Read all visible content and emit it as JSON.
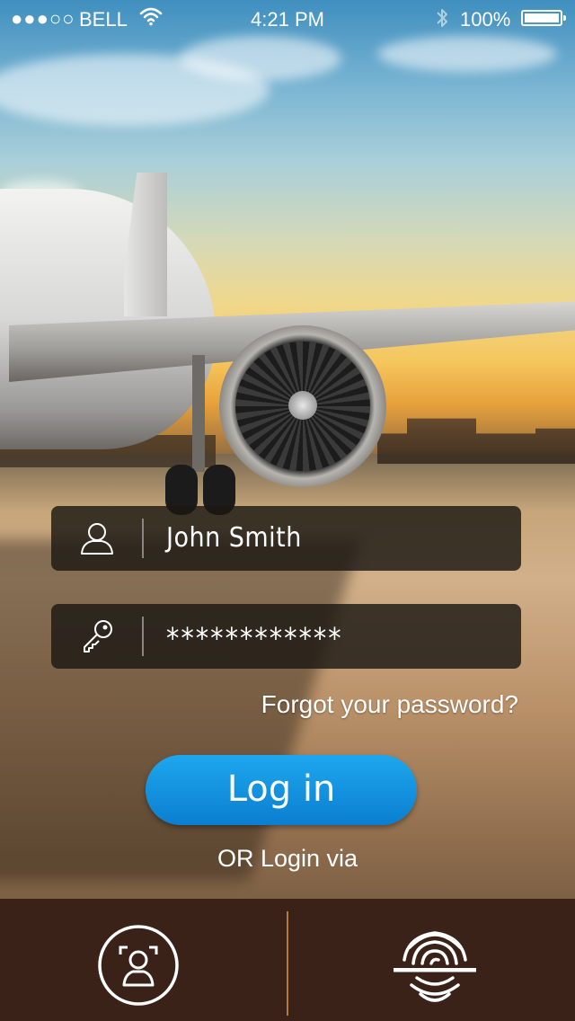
{
  "status_bar": {
    "signal": "●●●○○",
    "carrier": "BELL",
    "time": "4:21 PM",
    "battery": "100%"
  },
  "login_form": {
    "username_value": "John Smith",
    "password_value": "************",
    "forgot_password": "Forgot your password?",
    "login_button": "Log in",
    "alternative_label": "OR Login via"
  },
  "alt_login": {
    "options": [
      "face-recognition",
      "fingerprint"
    ]
  },
  "colors": {
    "button_blue": "#1296e0",
    "bottom_bar": "#3a2219",
    "separator": "#b87a32"
  }
}
